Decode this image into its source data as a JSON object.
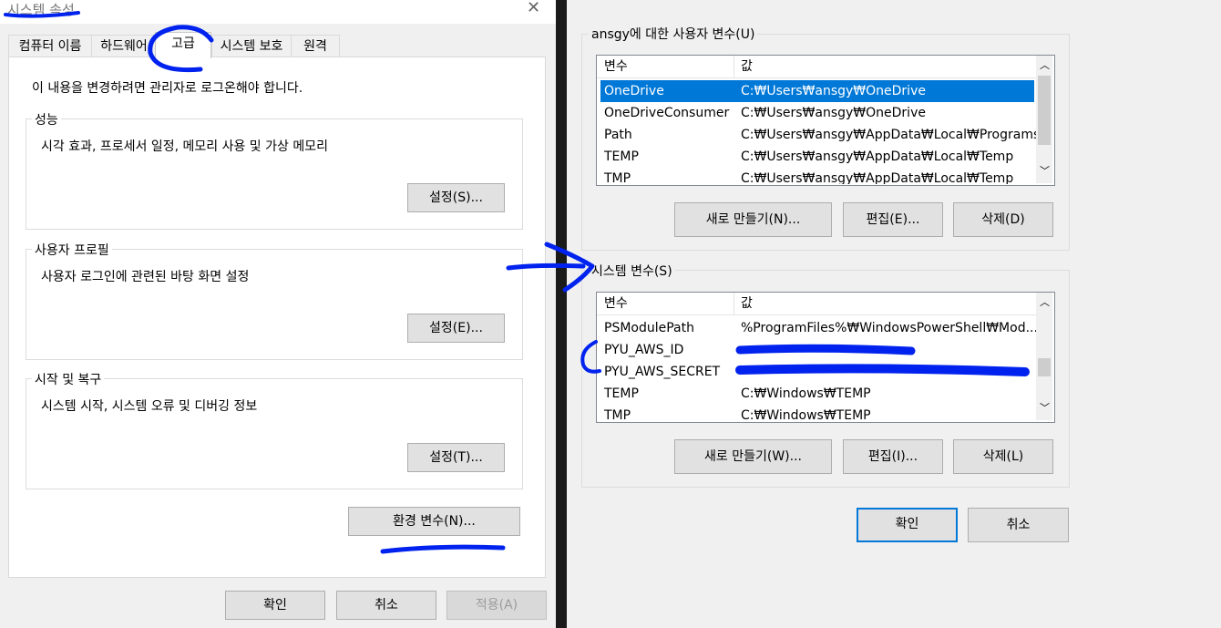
{
  "left": {
    "title": "시스템 속성",
    "tabs": [
      "컴퓨터 이름",
      "하드웨어",
      "고급",
      "시스템 보호",
      "원격"
    ],
    "notice": "이 내용을 변경하려면 관리자로 로그온해야 합니다.",
    "performance": {
      "label": "성능",
      "desc": "시각 효과, 프로세서 일정, 메모리 사용 및 가상 메모리",
      "button": "설정(S)..."
    },
    "profile": {
      "label": "사용자 프로필",
      "desc": "사용자 로그인에 관련된 바탕 화면 설정",
      "button": "설정(E)..."
    },
    "startup": {
      "label": "시작 및 복구",
      "desc": "시스템 시작, 시스템 오류 및 디버깅 정보",
      "button": "설정(T)..."
    },
    "env_button": "환경 변수(N)...",
    "ok": "확인",
    "cancel": "취소",
    "apply": "적용(A)"
  },
  "right": {
    "user_group_label": "ansgy에 대한 사용자 변수(U)",
    "col_var": "변수",
    "col_val": "값",
    "user_vars": [
      {
        "name": "OneDrive",
        "value": "C:₩Users₩ansgy₩OneDrive"
      },
      {
        "name": "OneDriveConsumer",
        "value": "C:₩Users₩ansgy₩OneDrive"
      },
      {
        "name": "Path",
        "value": "C:₩Users₩ansgy₩AppData₩Local₩Programs..."
      },
      {
        "name": "TEMP",
        "value": "C:₩Users₩ansgy₩AppData₩Local₩Temp"
      },
      {
        "name": "TMP",
        "value": "C:₩Users₩ansgy₩AppData₩Local₩Temp"
      }
    ],
    "user_buttons": {
      "new": "새로 만들기(N)...",
      "edit": "편집(E)...",
      "delete": "삭제(D)"
    },
    "sys_group_label": "시스템 변수(S)",
    "sys_vars": [
      {
        "name": "PSModulePath",
        "value": "%ProgramFiles%₩WindowsPowerShell₩Mod..."
      },
      {
        "name": "PYU_AWS_ID",
        "value": ""
      },
      {
        "name": "PYU_AWS_SECRET",
        "value": ""
      },
      {
        "name": "TEMP",
        "value": "C:₩Windows₩TEMP"
      },
      {
        "name": "TMP",
        "value": "C:₩Windows₩TEMP"
      }
    ],
    "sys_buttons": {
      "new": "새로 만들기(W)...",
      "edit": "편집(I)...",
      "delete": "삭제(L)"
    },
    "ok": "확인",
    "cancel": "취소"
  },
  "colors": {
    "ink": "#0022ee",
    "selection": "#0078d7"
  }
}
